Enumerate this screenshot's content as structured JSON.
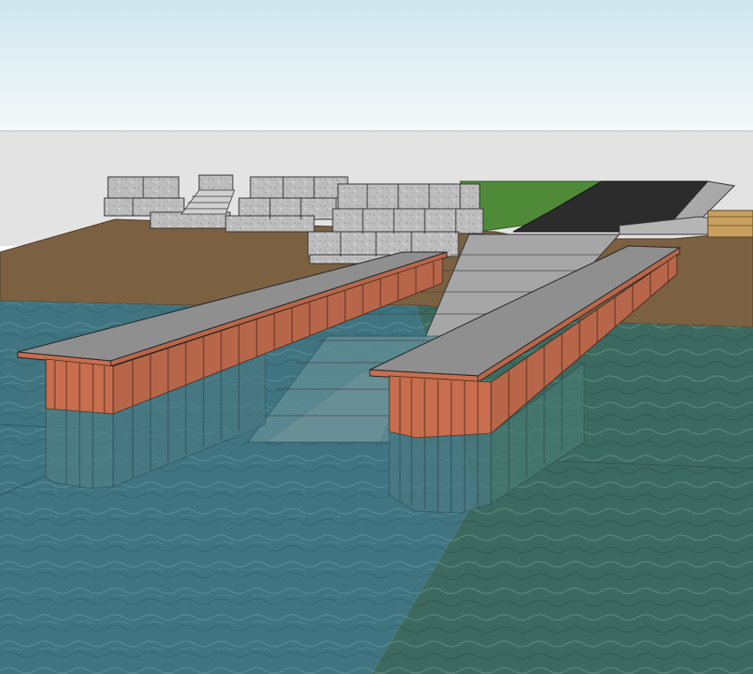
{
  "scene": {
    "colors": {
      "sky_top": "#cfe6ee",
      "sky_bottom": "#f4f9fa",
      "horizon": "#e3e3e3",
      "soil": "#7b6142",
      "soil_dark": "#6a5035",
      "water": "#3f7480",
      "water_alt": "#4f8590",
      "water_right": "#3d6a60",
      "deck": "#8a8a8a",
      "deck_top": "#9a9a9a",
      "pile": "#c86e4e",
      "pile_dark": "#a85a40",
      "stone": "#b8b8b8",
      "stone_dark": "#9a9a9a",
      "grass": "#4f8a38",
      "asphalt": "#2c2c2c",
      "ramp": "#a6a6a6"
    },
    "icons": []
  }
}
